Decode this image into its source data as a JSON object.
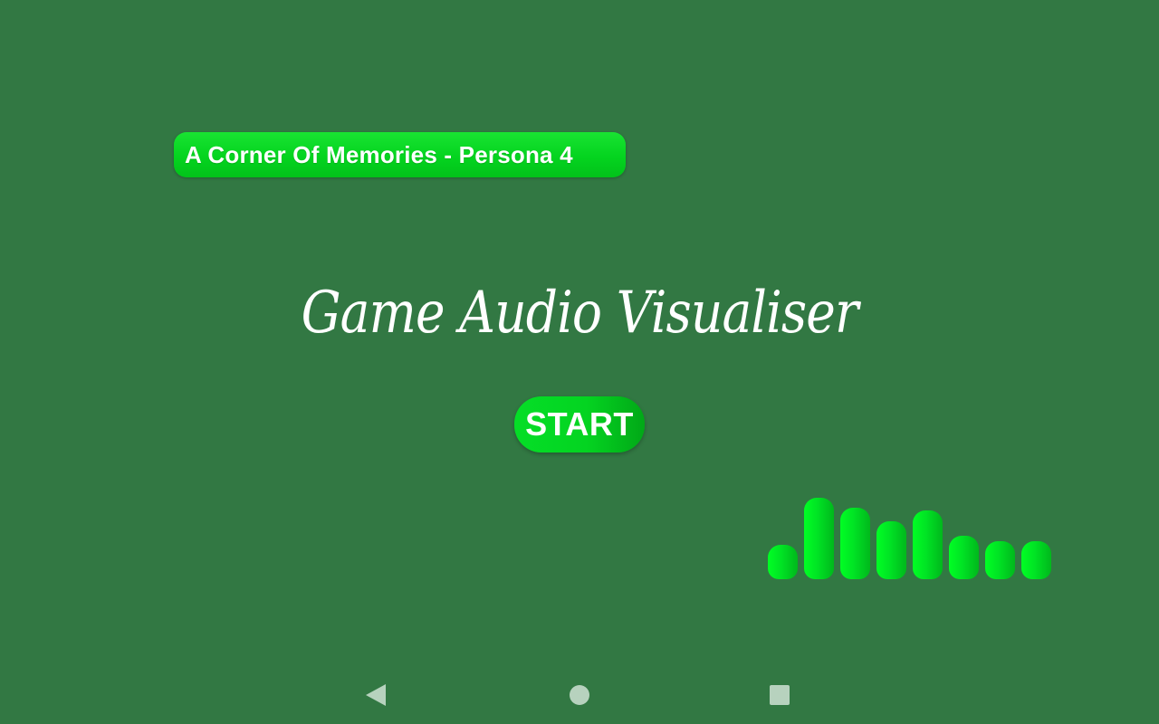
{
  "now_playing": {
    "track_label": "A Corner Of Memories - Persona 4"
  },
  "title": {
    "text": "Game Audio Visualiser"
  },
  "start_button": {
    "label": "START"
  },
  "visualiser": {
    "bar_color": "#00e324",
    "levels": [
      0.38,
      0.9,
      0.79,
      0.64,
      0.76,
      0.48,
      0.42,
      0.42
    ]
  },
  "background_color": "#327843",
  "system_nav": {
    "icons": [
      "back-icon",
      "home-icon",
      "recents-icon"
    ]
  }
}
